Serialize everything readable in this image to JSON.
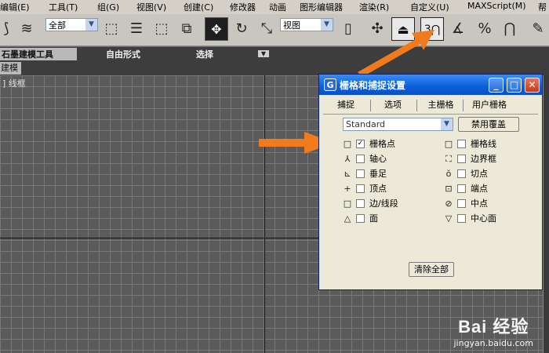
{
  "menubar": {
    "items": [
      "编辑(E)",
      "工具(T)",
      "组(G)",
      "视图(V)",
      "创建(C)",
      "修改器",
      "动画",
      "图形编辑器",
      "渲染(R)",
      "自定义(U)",
      "MAXScript(M)",
      "帮"
    ]
  },
  "toolbar": {
    "selection_filter": "全部",
    "reference_coord": "视图",
    "snap_toggle_value": "3",
    "icons": [
      "select-link-icon",
      "unlink-icon",
      "select-object-icon",
      "select-by-name-icon",
      "rect-select-region-icon",
      "window-crossing-icon",
      "select-move-icon",
      "select-rotate-icon",
      "select-scale-icon",
      "pivot-icon",
      "manipulate-icon",
      "keyboard-shortcut-icon",
      "snap-toggle-icon",
      "angle-snap-icon",
      "percent-snap-icon",
      "spinner-snap-icon",
      "edit-named-selection-icon"
    ]
  },
  "ribbon": {
    "tabs": [
      "石墨建模工具",
      "自由形式",
      "选择"
    ]
  },
  "subtab": {
    "label": "建模"
  },
  "viewport": {
    "label": "] 线框"
  },
  "dialog": {
    "title": "栅格和捕捉设置",
    "tabs": [
      "捕捉",
      "选项",
      "主栅格",
      "用户栅格"
    ],
    "preset": "Standard",
    "override_button": "禁用覆盖",
    "clear_button": "清除全部",
    "snaps_left": [
      {
        "symbol": "□",
        "label": "栅格点",
        "checked": true
      },
      {
        "symbol": "⅄",
        "label": "轴心",
        "checked": false
      },
      {
        "symbol": "⊾",
        "label": "垂足",
        "checked": false
      },
      {
        "symbol": "+",
        "label": "顶点",
        "checked": false
      },
      {
        "symbol": "□",
        "label": "边/线段",
        "checked": false
      },
      {
        "symbol": "△",
        "label": "面",
        "checked": false
      }
    ],
    "snaps_right": [
      {
        "symbol": "□",
        "label": "栅格线",
        "checked": false
      },
      {
        "symbol": "⛶",
        "label": "边界框",
        "checked": false
      },
      {
        "symbol": "ŏ",
        "label": "切点",
        "checked": false
      },
      {
        "symbol": "⊡",
        "label": "端点",
        "checked": false
      },
      {
        "symbol": "⊘",
        "label": "中点",
        "checked": false
      },
      {
        "symbol": "▽",
        "label": "中心面",
        "checked": false
      }
    ]
  },
  "watermark": {
    "logo": "Bai 经验",
    "url": "jingyan.baidu.com"
  },
  "colors": {
    "annotation_arrow": "#f07a1c",
    "dialog_title_bar": "#0a5fd8",
    "viewport_bg": "#5b5b5b"
  }
}
